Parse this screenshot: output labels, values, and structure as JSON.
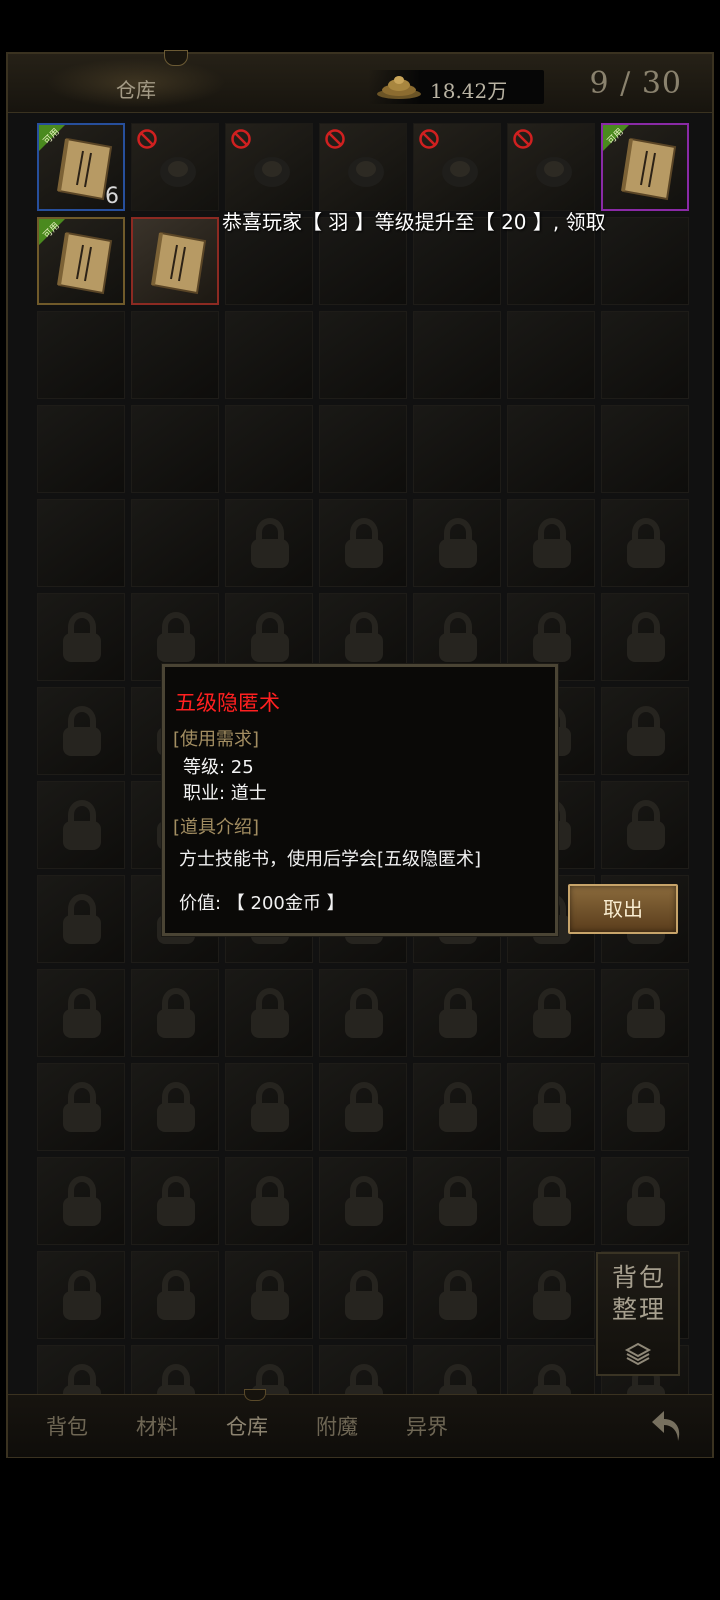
{
  "header": {
    "title": "仓库",
    "currency_value": "18.42万",
    "capacity": "9 / 30"
  },
  "items": [
    {
      "name": "skill-book",
      "frame": "blue",
      "badge": "可用",
      "count": "6"
    },
    {
      "name": "helmet",
      "frame": "dark",
      "unusable": true
    },
    {
      "name": "gem",
      "frame": "dark",
      "unusable": true
    },
    {
      "name": "armor",
      "frame": "dark",
      "unusable": true
    },
    {
      "name": "mask",
      "frame": "dark",
      "unusable": true
    },
    {
      "name": "gem-2",
      "frame": "dark",
      "unusable": true
    },
    {
      "name": "skill-book-2",
      "frame": "purple",
      "badge": "可用"
    },
    {
      "name": "skill-book-3",
      "frame": "gold",
      "badge": "可用"
    },
    {
      "name": "skill-book-4",
      "frame": "red",
      "selected": true
    }
  ],
  "notice": "恭喜玩家【 羽 】等级提升至【 20 】, 领取",
  "tooltip": {
    "title": "五级隐匿术",
    "req_header": "[使用需求]",
    "level": "等级: 25",
    "class": "职业: 道士",
    "desc_header": "[道具介绍]",
    "desc": "方士技能书，使用后学会[五级隐匿术]",
    "value": "价值: 【 200金币 】"
  },
  "take_button": "取出",
  "sort_button": {
    "line1": "背包",
    "line2": "整理"
  },
  "tabs": [
    "背包",
    "材料",
    "仓库",
    "附魔",
    "异界"
  ],
  "active_tab": "仓库",
  "colors": {
    "item_name": "#ff2020",
    "section_header": "#a38e62",
    "usable_badge": "#4a8a1e"
  }
}
